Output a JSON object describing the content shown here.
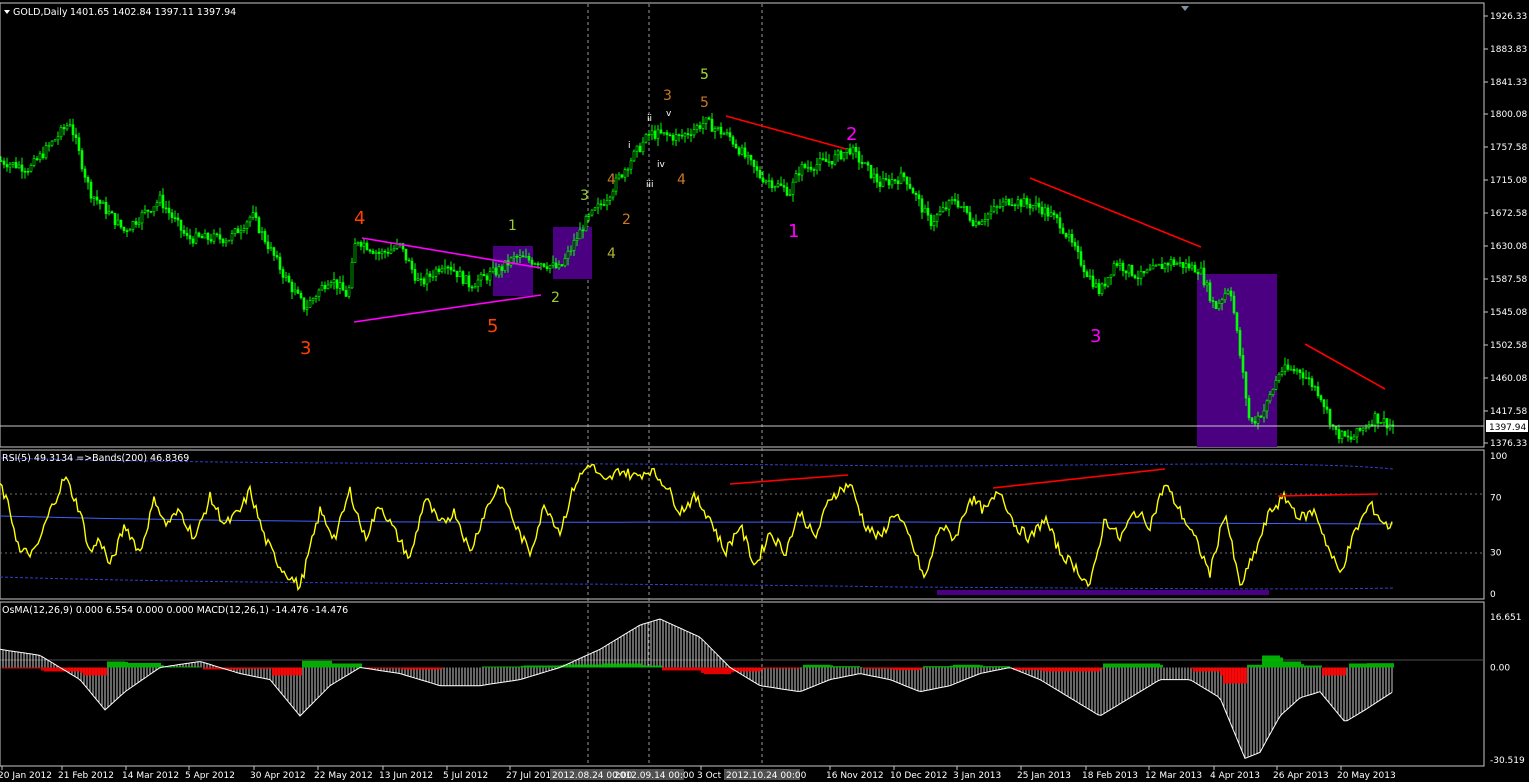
{
  "chart_data": [
    {
      "type": "candlestick",
      "title": "GOLD,Daily  1401.65 1402.84 1397.11 1397.94",
      "symbol": "GOLD,Daily",
      "ohlc_header": "1401.65 1402.84 1397.11 1397.94",
      "ylim": [
        1360,
        1940
      ],
      "yticks": [
        "1926.33",
        "1883.83",
        "1841.33",
        "1800.08",
        "1757.58",
        "1715.08",
        "1672.58",
        "1630.08",
        "1587.58",
        "1545.08",
        "1502.58",
        "1460.08",
        "1417.58",
        "1376.33"
      ],
      "current_price": "1397.94",
      "colors": {
        "up": "#00ff00",
        "down": "#00ff00",
        "background": "#000000",
        "grid": "#c0c0c0",
        "trendline": "#ff0000",
        "triangle": "#ff00ff",
        "box": "#4b0082"
      },
      "x": [
        "20 Jan 2012",
        "21 Feb 2012",
        "14 Mar 2012",
        "5 Apr 2012",
        "30 Apr 2012",
        "22 May 2012",
        "13 Jun 2012",
        "5 Jul 2012",
        "27 Jul 2012",
        "3 Oct 2012",
        "16 Nov 2012",
        "10 Dec 2012",
        "3 Jan 2013",
        "25 Jan 2013",
        "18 Feb 2013",
        "12 Mar 2013",
        "4 Apr 2013",
        "26 Apr 2013",
        "20 May 2013"
      ],
      "close_path": [
        {
          "x": "20 Jan 2012",
          "y": 1720
        },
        {
          "x": "21 Feb 2012",
          "y": 1785
        },
        {
          "x": "14 Mar 2012",
          "y": 1648
        },
        {
          "x": "5 Apr 2012",
          "y": 1645
        },
        {
          "x": "30 Apr 2012",
          "y": 1655
        },
        {
          "x": "22 May 2012",
          "y": 1545
        },
        {
          "x": "13 Jun 2012",
          "y": 1620
        },
        {
          "x": "5 Jul 2012",
          "y": 1585
        },
        {
          "x": "27 Jul 2012",
          "y": 1605
        },
        {
          "x": "3 Oct 2012",
          "y": 1785
        },
        {
          "x": "16 Nov 2012",
          "y": 1725
        },
        {
          "x": "10 Dec 2012",
          "y": 1680
        },
        {
          "x": "3 Jan 2013",
          "y": 1670
        },
        {
          "x": "25 Jan 2013",
          "y": 1670
        },
        {
          "x": "18 Feb 2013",
          "y": 1580
        },
        {
          "x": "12 Mar 2013",
          "y": 1600
        },
        {
          "x": "4 Apr 2013",
          "y": 1560
        },
        {
          "x": "26 Apr 2013",
          "y": 1460
        },
        {
          "x": "20 May 2013",
          "y": 1397.94
        }
      ],
      "wave_labels": [
        "3",
        "4",
        "5",
        "1",
        "2",
        "3",
        "4",
        "1",
        "2",
        "3",
        "4",
        "5",
        "i",
        "ii",
        "iii",
        "iv",
        "v",
        "3",
        "4",
        "5",
        "5",
        "1",
        "2",
        "3"
      ],
      "time_markers": [
        "2012.08.24 00:00",
        "2012.09.14 00:00",
        "2012.10.24 00:00"
      ]
    },
    {
      "type": "line",
      "title": "RSI(5) 49.3134  =>Bands(200) 46.8369",
      "ylim": [
        0,
        100
      ],
      "yticks": [
        "100",
        "70",
        "30",
        "0"
      ],
      "series": [
        {
          "name": "RSI(5)",
          "value": "49.3134",
          "color": "#ffff00"
        },
        {
          "name": "Bands(200)",
          "value": "46.8369",
          "color": "#3366ff"
        }
      ]
    },
    {
      "type": "bar",
      "title": "OsMA(12,26,9) 0.000 6.554 0.000 0.000  MACD(12,26,1) -14.476 -14.476",
      "ylim": [
        -30.519,
        16.651
      ],
      "yticks": [
        "16.651",
        "0.00",
        "-30.519"
      ],
      "series": [
        {
          "name": "OsMA(12,26,9)",
          "color": "#00c000"
        },
        {
          "name": "MACD(12,26,1)",
          "color": "#ffffff"
        }
      ]
    }
  ]
}
